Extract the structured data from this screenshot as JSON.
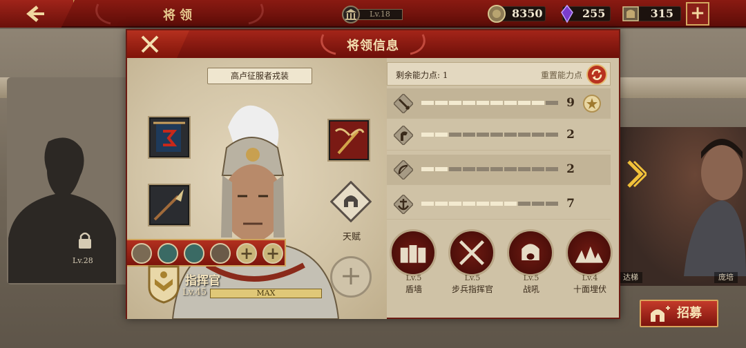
{
  "topbar": {
    "title": "将领",
    "building_level": "Lv.18",
    "resources": [
      {
        "icon": "gold-coin-icon",
        "value": "8350"
      },
      {
        "icon": "purple-gem-icon",
        "value": "255"
      },
      {
        "icon": "helmet-token-icon",
        "value": "315"
      }
    ]
  },
  "background": {
    "locked_level": "Lv.28",
    "right_names": [
      "达梯",
      "庞培"
    ]
  },
  "recruit_label": "招募",
  "modal": {
    "title": "将领信息",
    "outfit_label": "高卢征服者戎装",
    "talent_label": "天赋",
    "role_name": "指挥官",
    "level": "Lv.45",
    "exp_label": "MAX",
    "remaining_points_label": "剩余能力点: 1",
    "reset_label": "重置能力点",
    "stats": [
      {
        "icon": "sword-icon",
        "value": 9,
        "filled": 9
      },
      {
        "icon": "horse-icon",
        "value": 2,
        "filled": 2
      },
      {
        "icon": "bow-icon",
        "value": 2,
        "filled": 2
      },
      {
        "icon": "anchor-icon",
        "value": 7,
        "filled": 7
      }
    ],
    "tactics": [
      {
        "level": "Lv.5",
        "name": "盾墙"
      },
      {
        "level": "Lv.5",
        "name": "步兵指挥官"
      },
      {
        "level": "Lv.5",
        "name": "战吼"
      },
      {
        "level": "Lv.4",
        "name": "十面埋伏"
      }
    ]
  },
  "colors": {
    "banner_red": "#8a1a12",
    "gold_trim": "#d4a860",
    "parchment": "#cfc2a6"
  }
}
